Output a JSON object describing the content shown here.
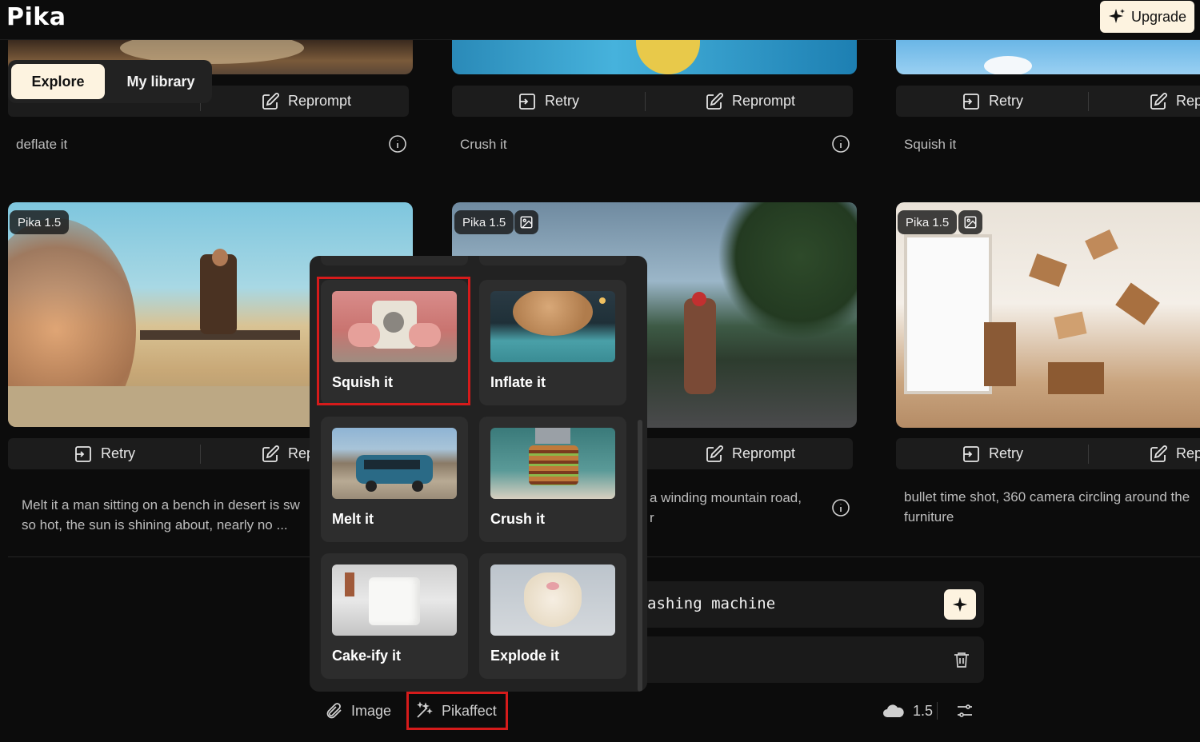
{
  "app": {
    "logo": "Pika"
  },
  "header": {
    "upgrade_label": "Upgrade"
  },
  "tabs": [
    {
      "label": "Explore",
      "active": true
    },
    {
      "label": "My library",
      "active": false
    }
  ],
  "labels": {
    "retry": "Retry",
    "reprompt": "Reprompt"
  },
  "top_cards": [
    {
      "caption": "deflate it"
    },
    {
      "caption": "Crush it"
    },
    {
      "caption": "Squish it"
    }
  ],
  "mid_cards": [
    {
      "badge": "Pika 1.5",
      "has_image_badge": false,
      "retry": "Retry",
      "reprompt": "Rep",
      "caption_line1": "Melt it a man sitting on a bench in desert is sw",
      "caption_line2": "so hot, the sun is shining about, nearly no ..."
    },
    {
      "badge": "Pika 1.5",
      "has_image_badge": true,
      "retry": "",
      "reprompt": "Reprompt",
      "caption_line1": "a winding mountain road,",
      "caption_line2": "r"
    },
    {
      "badge": "Pika 1.5",
      "has_image_badge": true,
      "retry": "Retry",
      "reprompt": "Rep",
      "caption_line1": "bullet time shot, 360 camera circling around the",
      "caption_line2": "furniture"
    }
  ],
  "prompt": {
    "value": "ashing machine"
  },
  "bottom_toolbar": {
    "image_label": "Image",
    "pikaffect_label": "Pikaffect",
    "version": "1.5"
  },
  "pikaffects": [
    {
      "label": "Squish it",
      "selected": true
    },
    {
      "label": "Inflate it",
      "selected": false
    },
    {
      "label": "Melt it",
      "selected": false
    },
    {
      "label": "Crush it",
      "selected": false
    },
    {
      "label": "Cake-ify it",
      "selected": false
    },
    {
      "label": "Explode it",
      "selected": false
    }
  ],
  "colors": {
    "background": "#0c0c0c",
    "accent_cream": "#fdf3e0",
    "highlight_red": "#d61b1b",
    "surface": "#1c1c1c"
  }
}
